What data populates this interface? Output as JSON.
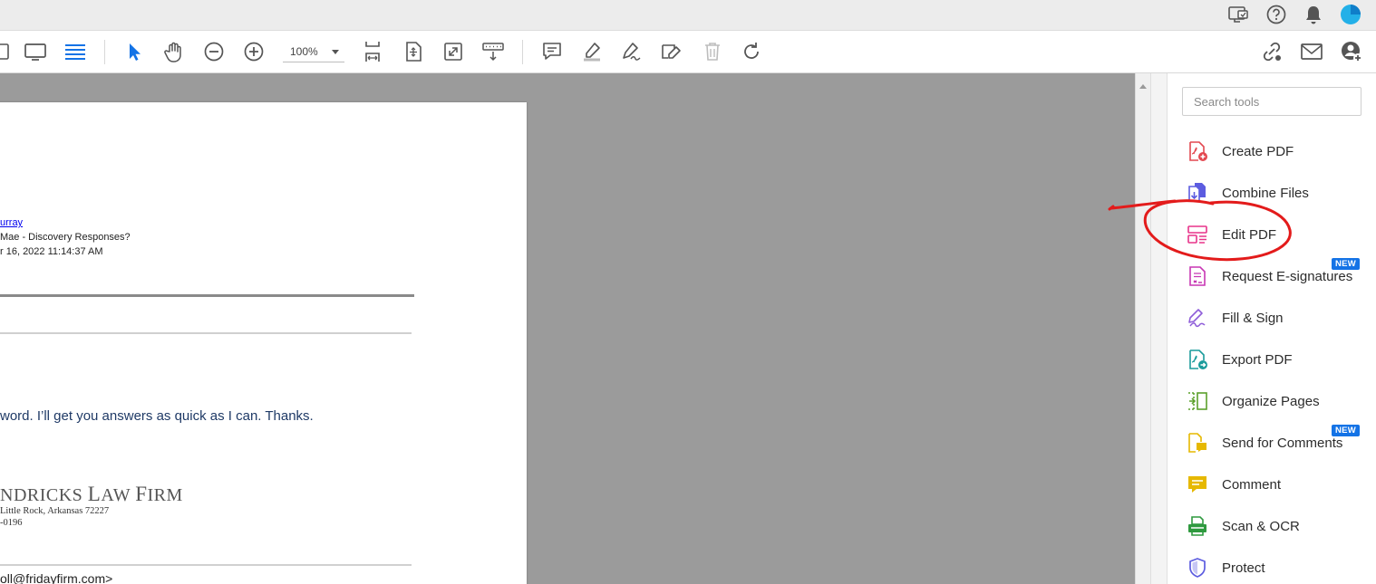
{
  "toolbar": {
    "zoom_value": "100%"
  },
  "document": {
    "header_lines": [
      {
        "text": "urray",
        "link": true
      },
      {
        "text": "Mae - Discovery Responses?",
        "link": false
      },
      {
        "text": "r 16, 2022 11:14:37 AM",
        "link": false
      }
    ],
    "body_text": "word.  I’ll get you answers as quick as I can.  Thanks.",
    "firm_name_parts": [
      "NDRICKS ",
      "L",
      "AW ",
      "F",
      "IRM"
    ],
    "address_line1": "Little Rock, Arkansas  72227",
    "address_line2": "-0196",
    "email_fragment": "oll@fridayfirm.com>"
  },
  "tools_pane": {
    "search_placeholder": "Search tools",
    "tools": [
      {
        "label": "Create PDF",
        "icon": "create-pdf-icon",
        "color": "#e34850"
      },
      {
        "label": "Combine Files",
        "icon": "combine-files-icon",
        "color": "#5c5ce0"
      },
      {
        "label": "Edit PDF",
        "icon": "edit-pdf-icon",
        "color": "#e8348a"
      },
      {
        "label": "Request E-signatures",
        "icon": "request-esignatures-icon",
        "color": "#c837b4",
        "badge": "NEW"
      },
      {
        "label": "Fill & Sign",
        "icon": "fill-sign-icon",
        "color": "#8f5ed9"
      },
      {
        "label": "Export PDF",
        "icon": "export-pdf-icon",
        "color": "#1a9b9b"
      },
      {
        "label": "Organize Pages",
        "icon": "organize-pages-icon",
        "color": "#5ca02c"
      },
      {
        "label": "Send for Comments",
        "icon": "send-for-comments-icon",
        "color": "#e6b800",
        "badge": "NEW"
      },
      {
        "label": "Comment",
        "icon": "comment-icon",
        "color": "#e6b800"
      },
      {
        "label": "Scan & OCR",
        "icon": "scan-ocr-icon",
        "color": "#2f9a3f"
      },
      {
        "label": "Protect",
        "icon": "protect-icon",
        "color": "#5c5ce0"
      }
    ]
  },
  "colors": {
    "accent_blue": "#1473e6",
    "annotation_red": "#e31b1b",
    "viewer_gray": "#9b9b9b"
  }
}
